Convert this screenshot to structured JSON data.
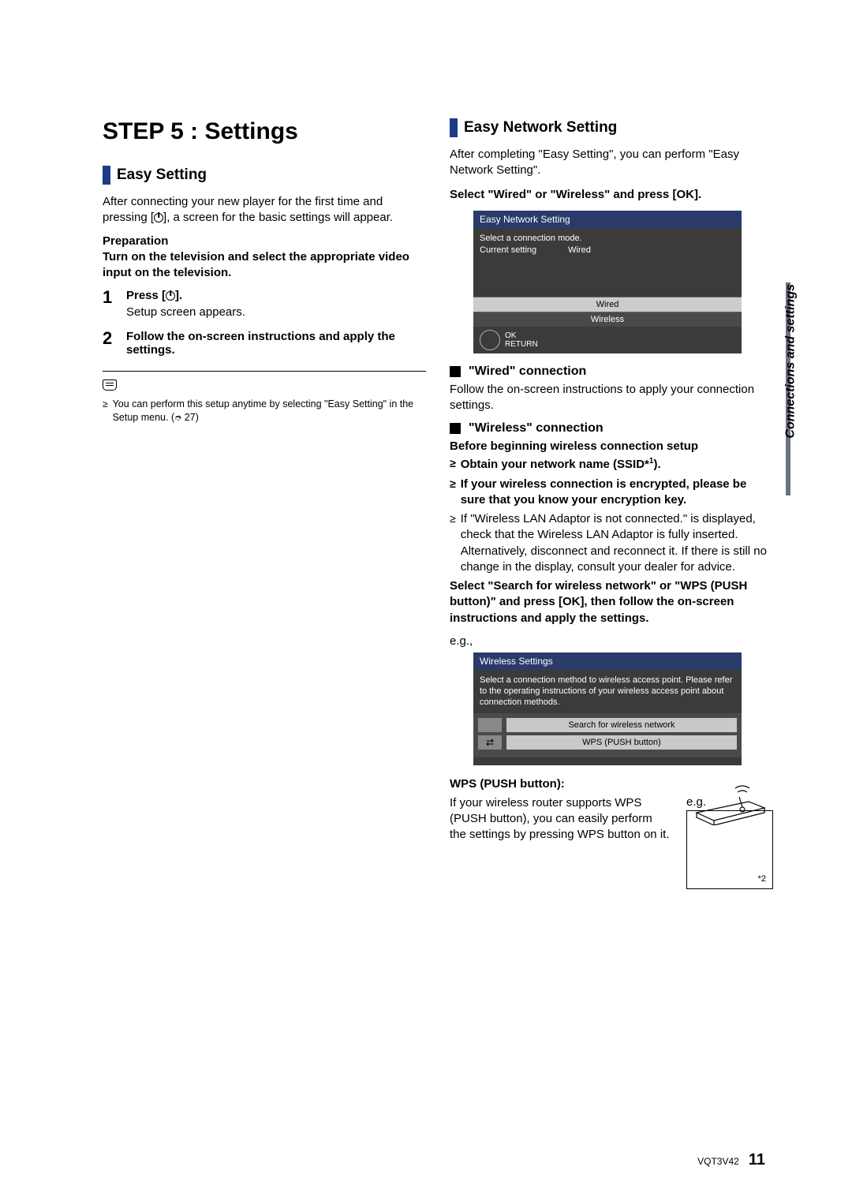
{
  "page": {
    "step_title": "STEP 5 : Settings",
    "side_tab": "Connections and settings",
    "footer_code": "VQT3V42",
    "page_number": "11"
  },
  "left": {
    "section_title": "Easy Setting",
    "intro_a": "After connecting your new player for the first time and pressing [",
    "intro_b": "], a screen for the basic settings will appear.",
    "prep_label": "Preparation",
    "prep_text": "Turn on the television and select the appropriate video input on the television.",
    "steps": [
      {
        "num": "1",
        "head_a": "Press [",
        "head_b": "].",
        "desc": "Setup screen appears."
      },
      {
        "num": "2",
        "head": "Follow the on-screen instructions and apply the settings.",
        "desc": ""
      }
    ],
    "note_a": "You can perform this setup anytime by selecting \"Easy Setting\" in the Setup menu. (",
    "note_ref": " 27)"
  },
  "right": {
    "section_title": "Easy Network Setting",
    "intro": "After completing \"Easy Setting\", you can perform \"Easy Network Setting\".",
    "select_line": "Select \"Wired\" or \"Wireless\" and press [OK].",
    "screen1": {
      "title": "Easy Network Setting",
      "line1": "Select a connection mode.",
      "line2a": "Current setting",
      "line2b": "Wired",
      "opt_wired": "Wired",
      "opt_wireless": "Wireless",
      "ok": "OK",
      "return": "RETURN"
    },
    "wired_head": "\"Wired\" connection",
    "wired_text": "Follow the on-screen instructions to apply your connection settings.",
    "wireless_head": "\"Wireless\" connection",
    "wireless_before": "Before beginning wireless connection setup",
    "wireless_bullets_bold": [
      "Obtain your network name (SSID*1).",
      "If your wireless connection is encrypted, please be sure that you know your encryption key."
    ],
    "wireless_bullet_plain": "If \"Wireless LAN Adaptor is not connected.\" is displayed, check that the Wireless LAN Adaptor is fully inserted. Alternatively, disconnect and reconnect it. If there is still no change in the display, consult your dealer for advice.",
    "wireless_select": "Select \"Search for wireless network\" or \"WPS (PUSH button)\" and press [OK], then follow the on-screen instructions and apply the settings.",
    "eg": "e.g.,",
    "screen2": {
      "title": "Wireless Settings",
      "desc": "Select a connection method to wireless access point. Please refer to the operating instructions of your wireless access point about connection methods.",
      "opt1": "Search for wireless network",
      "opt2": "WPS (PUSH button)"
    },
    "wps_head": "WPS (PUSH button):",
    "wps_text": "If your wireless router supports WPS (PUSH button), you can easily perform the settings by pressing WPS button on it.",
    "router_eg": "e.g.",
    "router_note": "*2"
  }
}
